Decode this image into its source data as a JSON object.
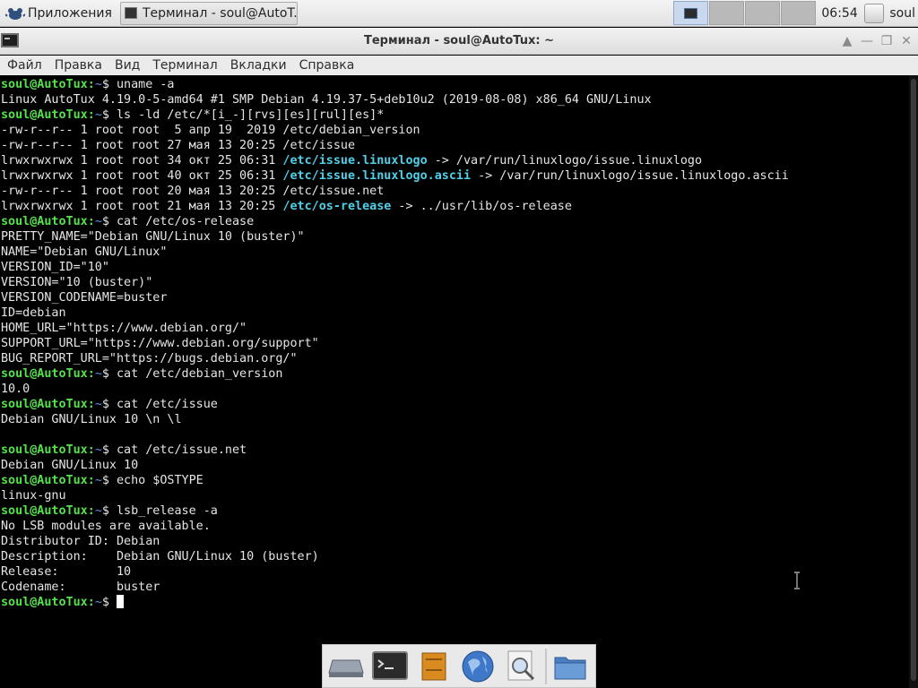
{
  "top_panel": {
    "apps_menu_label": "Приложения",
    "task_button_label": "Терминал - soul@AutoT...",
    "clock": "06:54",
    "user": "soul"
  },
  "window": {
    "title": "Терминал - soul@AutoTux: ~"
  },
  "menubar": {
    "items": [
      "Файл",
      "Правка",
      "Вид",
      "Терминал",
      "Вкладки",
      "Справка"
    ]
  },
  "prompt": {
    "user_host": "soul@AutoTux",
    "sep": ":",
    "path": "~",
    "symbol": "$ "
  },
  "terminal": {
    "lines": [
      {
        "cmd": "uname -a"
      },
      {
        "text": "Linux AutoTux 4.19.0-5-amd64 #1 SMP Debian 4.19.37-5+deb10u2 (2019-08-08) x86_64 GNU/Linux"
      },
      {
        "cmd": "ls -ld /etc/*[i_-][rvs][es][rul][es]*"
      },
      {
        "text": "-rw-r--r-- 1 root root  5 апр 19  2019 /etc/debian_version"
      },
      {
        "text": "-rw-r--r-- 1 root root 27 мая 13 20:25 /etc/issue"
      },
      {
        "text": "lrwxrwxrwx 1 root root 34 окт 25 06:31 ",
        "link": "/etc/issue.linuxlogo",
        "after": " -> /var/run/linuxlogo/issue.linuxlogo"
      },
      {
        "text": "lrwxrwxrwx 1 root root 40 окт 25 06:31 ",
        "link": "/etc/issue.linuxlogo.ascii",
        "after": " -> /var/run/linuxlogo/issue.linuxlogo.ascii"
      },
      {
        "text": "-rw-r--r-- 1 root root 20 мая 13 20:25 /etc/issue.net"
      },
      {
        "text": "lrwxrwxrwx 1 root root 21 мая 13 20:25 ",
        "link": "/etc/os-release",
        "after": " -> ../usr/lib/os-release"
      },
      {
        "cmd": "cat /etc/os-release"
      },
      {
        "text": "PRETTY_NAME=\"Debian GNU/Linux 10 (buster)\""
      },
      {
        "text": "NAME=\"Debian GNU/Linux\""
      },
      {
        "text": "VERSION_ID=\"10\""
      },
      {
        "text": "VERSION=\"10 (buster)\""
      },
      {
        "text": "VERSION_CODENAME=buster"
      },
      {
        "text": "ID=debian"
      },
      {
        "text": "HOME_URL=\"https://www.debian.org/\""
      },
      {
        "text": "SUPPORT_URL=\"https://www.debian.org/support\""
      },
      {
        "text": "BUG_REPORT_URL=\"https://bugs.debian.org/\""
      },
      {
        "cmd": "cat /etc/debian_version"
      },
      {
        "text": "10.0"
      },
      {
        "cmd": "cat /etc/issue"
      },
      {
        "text": "Debian GNU/Linux 10 \\n \\l"
      },
      {
        "text": ""
      },
      {
        "cmd": "cat /etc/issue.net"
      },
      {
        "text": "Debian GNU/Linux 10"
      },
      {
        "cmd": "echo $OSTYPE"
      },
      {
        "text": "linux-gnu"
      },
      {
        "cmd": "lsb_release -a"
      },
      {
        "text": "No LSB modules are available."
      },
      {
        "text": "Distributor ID: Debian"
      },
      {
        "text": "Description:    Debian GNU/Linux 10 (buster)"
      },
      {
        "text": "Release:        10"
      },
      {
        "text": "Codename:       buster"
      },
      {
        "cmd": "",
        "cursor": true
      }
    ]
  },
  "dock": {
    "items": [
      "drive-icon",
      "terminal-icon",
      "file-cabinet-icon",
      "web-browser-icon",
      "search-icon",
      "folder-icon"
    ]
  }
}
